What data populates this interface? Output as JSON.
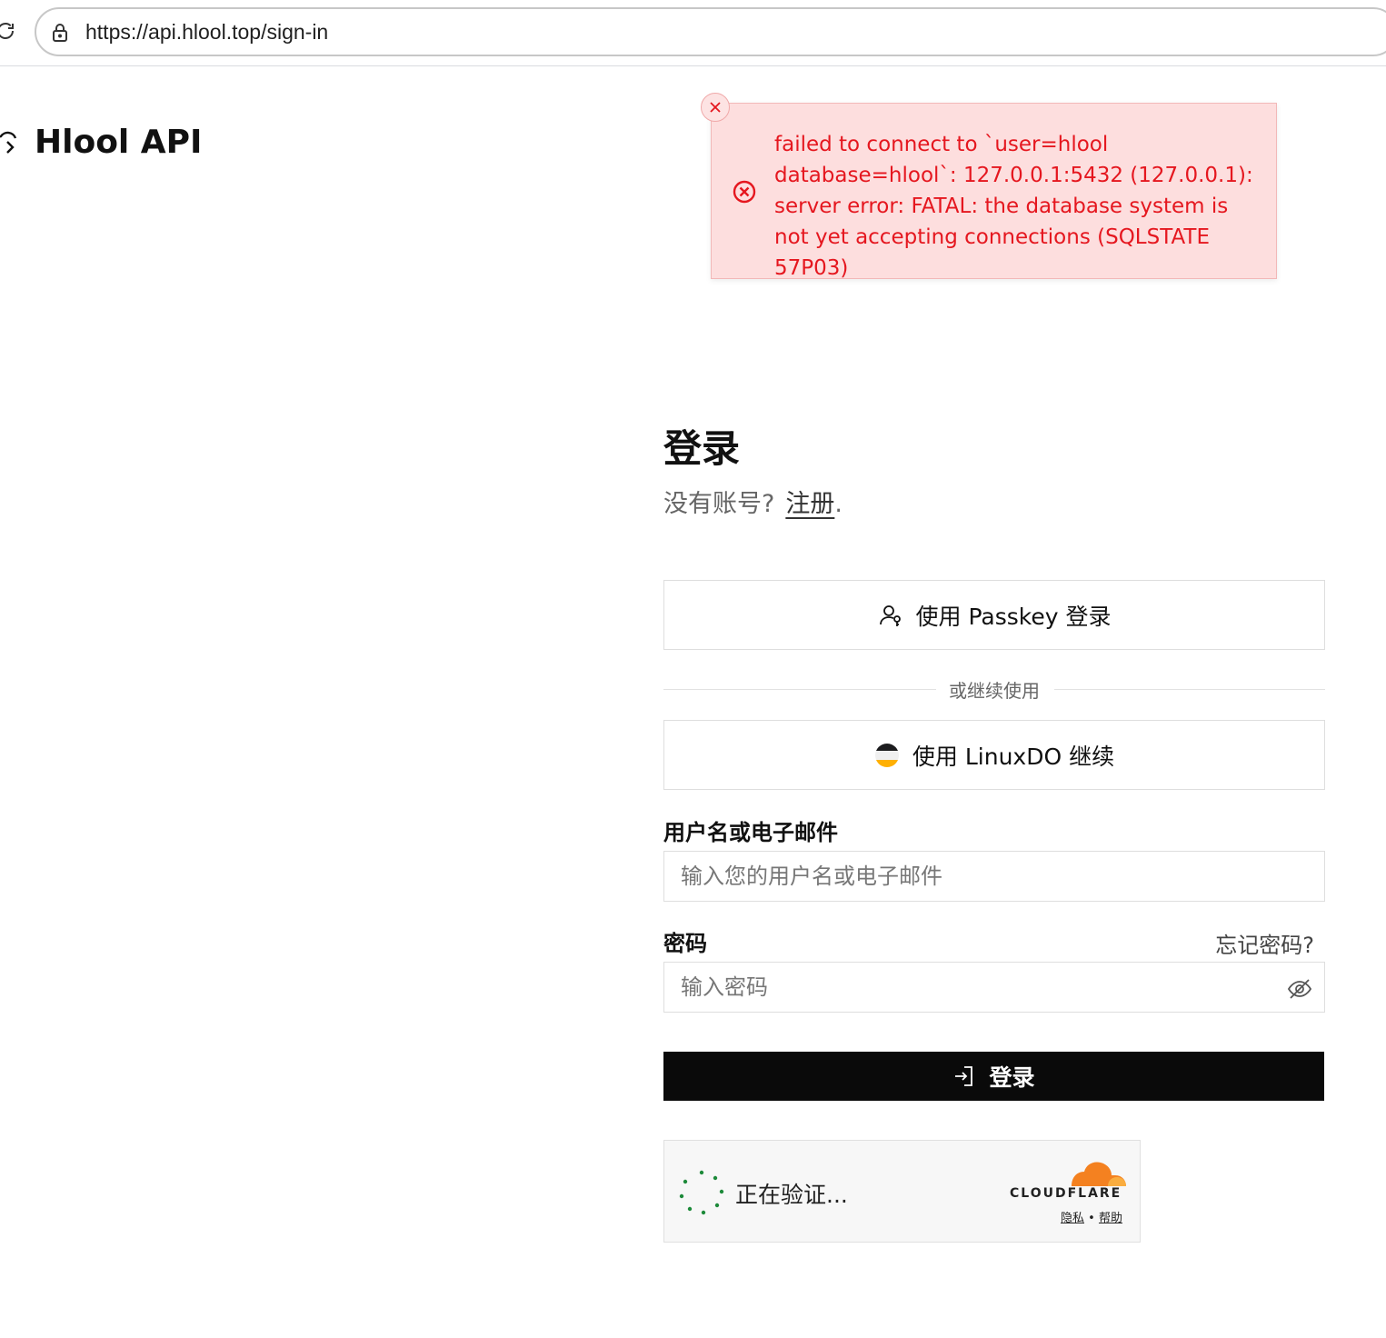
{
  "browser": {
    "url": "https://api.hlool.top/sign-in"
  },
  "brand": {
    "name": "Hlool API"
  },
  "toast": {
    "message": "failed to connect to `user=hlool database=hlool`: 127.0.0.1:5432 (127.0.0.1): server error: FATAL: the database system is not yet accepting connections (SQLSTATE 57P03)",
    "color": "#e5171f",
    "background": "#fddede"
  },
  "form": {
    "title": "登录",
    "no_account": "没有账号?",
    "register_link": "注册",
    "register_suffix": ".",
    "passkey_button": "使用 Passkey 登录",
    "divider": "或继续使用",
    "linuxdo_button": "使用 LinuxDO 继续",
    "username_label": "用户名或电子邮件",
    "username_placeholder": "输入您的用户名或电子邮件",
    "password_label": "密码",
    "forgot_password": "忘记密码?",
    "password_placeholder": "输入密码",
    "submit_button": "登录"
  },
  "turnstile": {
    "status": "正在验证...",
    "provider": "CLOUDFLARE",
    "privacy": "隐私",
    "separator": "•",
    "help": "帮助"
  },
  "icons": {
    "reload": "reload-icon",
    "lock": "lock-icon",
    "brand": "cloud-icon",
    "close": "close-icon",
    "error": "error-circle-icon",
    "passkey": "passkey-icon",
    "linuxdo": "linuxdo-logo-icon",
    "eye_off": "eye-off-icon",
    "login": "login-icon",
    "spinner": "spinner-icon",
    "cloudflare": "cloudflare-logo-icon"
  },
  "colors": {
    "primary_button": "#0a0a0a",
    "cloudflare_orange": "#f48120"
  }
}
